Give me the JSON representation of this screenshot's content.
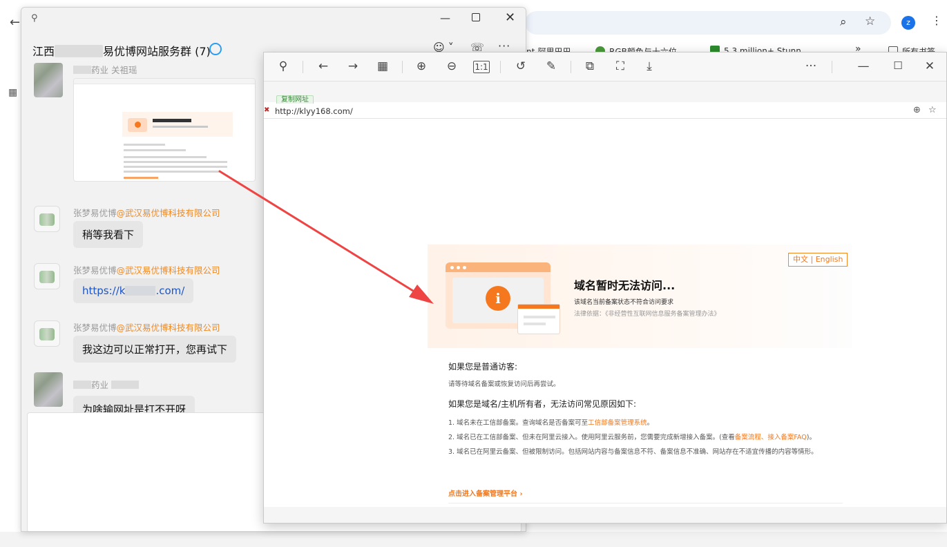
{
  "background_browser": {
    "bookmarks": [
      {
        "label": "nt-阿里巴巴",
        "icon": "page-icon"
      },
      {
        "label": "RGB颜色与十六位",
        "icon": "frog-icon"
      },
      {
        "label": "5.3 million+ Stunn",
        "icon": "qx-icon"
      },
      {
        "label": "所有书签",
        "icon": "folder-icon"
      }
    ],
    "more_bookmarks": "»",
    "profile_initial": "z"
  },
  "chat": {
    "group_title_prefix": "江西",
    "group_title_suffix": "易优博网站服务群 (7)",
    "messages": [
      {
        "sender": "药业 关祖瑶",
        "org": "",
        "type": "image"
      },
      {
        "sender": "张梦易优博",
        "org": "@武汉易优博科技有限公司",
        "text": "稍等我看下"
      },
      {
        "sender": "张梦易优博",
        "org": "@武汉易优博科技有限公司",
        "link_prefix": "https://k",
        "link_suffix": ".com/"
      },
      {
        "sender": "张梦易优博",
        "org": "@武汉易优博科技有限公司",
        "text": "我这边可以正常打开，您再试下"
      },
      {
        "sender": "药业",
        "org": "",
        "text": "为啥输网址是打不开呀"
      }
    ]
  },
  "viewer": {
    "copy_url_label": "复制网址",
    "url": "http://klyy168.com/",
    "lang_switch": "中文 | English",
    "hero_title": "域名暂时无法访问...",
    "hero_sub": "该域名当前备案状态不符合访问要求",
    "hero_law": "法律依据：《非经营性互联网信息服务备案管理办法》",
    "visitor_heading": "如果您是普通访客:",
    "visitor_text": "请等待域名备案或恢复访问后再尝试。",
    "owner_heading": "如果您是域名/主机所有者，无法访问常见原因如下:",
    "reason1_prefix": "1. 域名未在工信部备案。查询域名是否备案可至",
    "reason1_link": "工信部备案管理系统",
    "reason1_suffix": "。",
    "reason2_prefix": "2. 域名已在工信部备案、但未在阿里云接入。使用阿里云服务前，您需要完成新增接入备案。(查看",
    "reason2_link1": "备案流程",
    "reason2_sep": "、",
    "reason2_link2": "接入备案FAQ",
    "reason2_suffix": ")。",
    "reason3": "3. 域名已在阿里云备案、但被限制访问。包括网站内容与备案信息不符、备案信息不准确、网站存在不适宜传播的内容等情形。",
    "cta": "点击进入备案管理平台 ›"
  },
  "colors": {
    "accent_orange": "#f0781f",
    "annotation_arrow": "#ef4444",
    "link_blue": "#1c55c8"
  }
}
